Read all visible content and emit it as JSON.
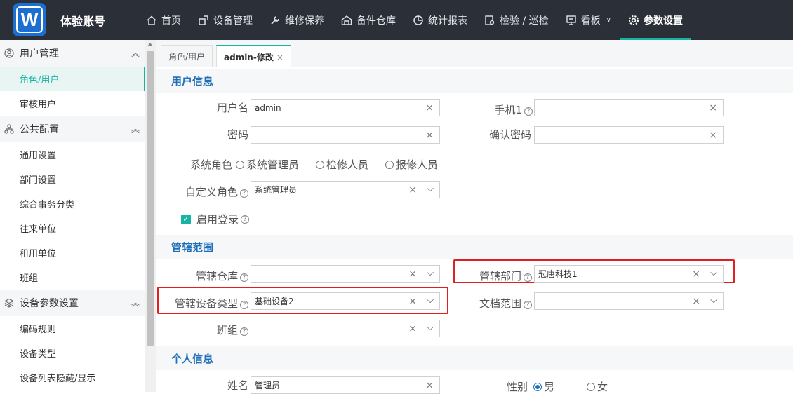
{
  "app": {
    "logo_letter": "W",
    "account": "体验账号"
  },
  "nav": [
    {
      "label": "首页",
      "icon": "home-icon"
    },
    {
      "label": "设备管理",
      "icon": "equipment-icon"
    },
    {
      "label": "维修保养",
      "icon": "wrench-icon"
    },
    {
      "label": "备件仓库",
      "icon": "warehouse-icon"
    },
    {
      "label": "统计报表",
      "icon": "pie-chart-icon"
    },
    {
      "label": "检验 / 巡检",
      "icon": "inspection-icon"
    },
    {
      "label": "看板",
      "icon": "board-icon"
    },
    {
      "label": "参数设置",
      "icon": "gear-icon"
    }
  ],
  "sidebar": {
    "groups": [
      {
        "label": "用户管理",
        "items": [
          "角色/用户",
          "审核用户"
        ]
      },
      {
        "label": "公共配置",
        "items": [
          "通用设置",
          "部门设置",
          "综合事务分类",
          "往来单位",
          "租用单位",
          "班组"
        ]
      },
      {
        "label": "设备参数设置",
        "items": [
          "编码规则",
          "设备类型",
          "设备列表隐藏/显示"
        ]
      }
    ]
  },
  "tabs": [
    {
      "label": "角色/用户"
    },
    {
      "label": "admin-修改",
      "close": "×"
    }
  ],
  "sections": {
    "user_info": "用户信息",
    "scope": "管辖范围",
    "personal": "个人信息"
  },
  "form": {
    "username_label": "用户名",
    "username_value": "admin",
    "phone_label": "手机1",
    "phone_value": "",
    "password_label": "密码",
    "password_value": "",
    "confirm_label": "确认密码",
    "confirm_value": "",
    "role_label": "系统角色",
    "role_options": [
      "系统管理员",
      "检修人员",
      "报修人员"
    ],
    "custom_role_label": "自定义角色",
    "custom_role_value": "系统管理员",
    "login_label": "启用登录",
    "warehouse_label": "管辖仓库",
    "warehouse_value": "",
    "dept_label": "管辖部门",
    "dept_value": "冠唐科技1",
    "devtype_label": "管辖设备类型",
    "devtype_value": "基础设备2",
    "doc_label": "文档范围",
    "doc_value": "",
    "team_label": "班组",
    "team_value": "",
    "name_label": "姓名",
    "name_value": "管理员",
    "gender_label": "性别",
    "gender_options": [
      "男",
      "女"
    ]
  },
  "glyphs": {
    "clear": "×",
    "arrow": "⌵",
    "help": "?",
    "collapse": "︽",
    "check": "✓"
  },
  "colors": {
    "accent": "#17b3a3",
    "section_title": "#1f6fb8",
    "nav_bg": "#2b3038",
    "highlight": "#e02020"
  }
}
